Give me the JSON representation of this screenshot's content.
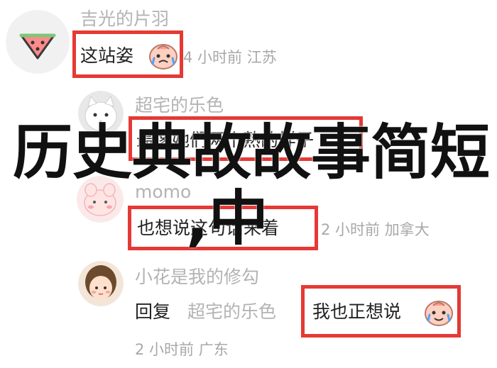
{
  "comments": [
    {
      "username": "吉光的片羽",
      "text": "这站姿",
      "meta": "4 小时前 江苏",
      "avatar": "watermelon-avatar"
    },
    {
      "username": "超宅的乐色",
      "text": "最像她们两个熟的样子",
      "meta": "",
      "avatar": "white-cat-avatar"
    },
    {
      "username": "momo",
      "text": "也想说这句话来着",
      "meta": "2 小时前 加拿大",
      "avatar": "pink-face-avatar"
    },
    {
      "username": "小花是我的修勾",
      "reply_label": "回复",
      "reply_to": "超宅的乐色",
      "text": "我也正想说",
      "meta": "2 小时前 广东",
      "avatar": "girl-avatar"
    }
  ],
  "overlay": {
    "title": "历史典故故事简短",
    "subtitle": ",中"
  },
  "colors": {
    "highlight": "#e53935",
    "username": "#b3b3b3",
    "text": "#222222",
    "meta": "#a8a8a8"
  }
}
